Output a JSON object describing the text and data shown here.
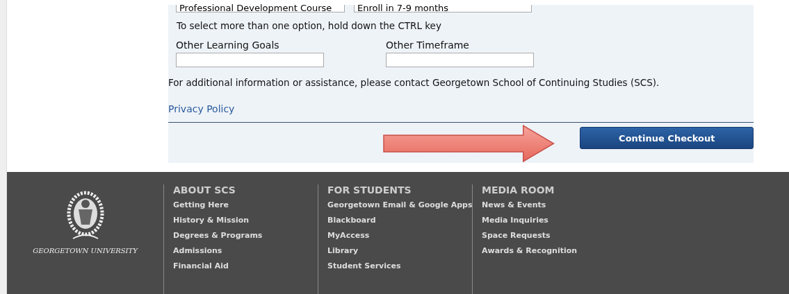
{
  "selects": [
    {
      "value": "Professional Development Course"
    },
    {
      "value": "Enroll in 7-9 months"
    }
  ],
  "hint": "To select more than one option, hold down the CTRL key",
  "fields": [
    {
      "label": "Other Learning Goals"
    },
    {
      "label": "Other Timeframe"
    }
  ],
  "info": "For additional information or assistance, please contact Georgetown School of Continuing Studies (SCS).",
  "privacy_link": "Privacy Policy",
  "checkout_button": "Continue Checkout",
  "footer": {
    "logo_text": "GEORGETOWN UNIVERSITY",
    "columns": [
      {
        "title": "ABOUT SCS",
        "links": [
          "Getting Here",
          "History & Mission",
          "Degrees & Programs",
          "Admissions",
          "Financial Aid"
        ]
      },
      {
        "title": "FOR STUDENTS",
        "links": [
          "Georgetown Email & Google Apps",
          "Blackboard",
          "MyAccess",
          "Library",
          "Student Services"
        ]
      },
      {
        "title": "MEDIA ROOM",
        "links": [
          "News & Events",
          "Media Inquiries",
          "Space Requests",
          "Awards & Recognition"
        ]
      }
    ]
  }
}
